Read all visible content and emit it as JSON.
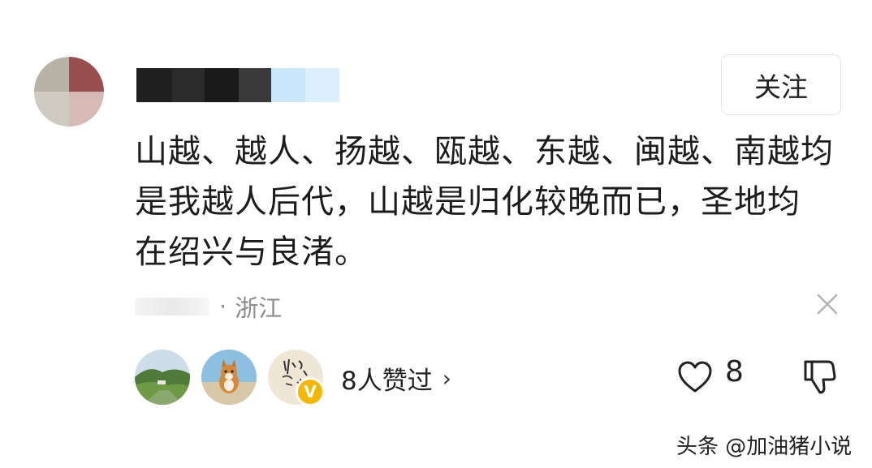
{
  "header": {
    "follow_label": "关注"
  },
  "comment": {
    "lines": [
      "山越、越人、扬越、瓯越、东越、闽越、南越均",
      "是我越人后代，山越是归化较晚而已，圣地均",
      "在绍兴与良渚。"
    ],
    "location": "浙江",
    "separator": "·"
  },
  "likes": {
    "liked_by_label": "8人赞过",
    "chevron": "›",
    "count": "8",
    "liker_icons": [
      "landscape-avatar",
      "corgi-avatar",
      "calligraphy-avatar"
    ]
  },
  "watermark": {
    "text": "头条 @加油猪小说"
  },
  "colors": {
    "text": "#1c1c1c",
    "secondary": "#8c8c8c",
    "verified_badge": "#f5b800"
  }
}
